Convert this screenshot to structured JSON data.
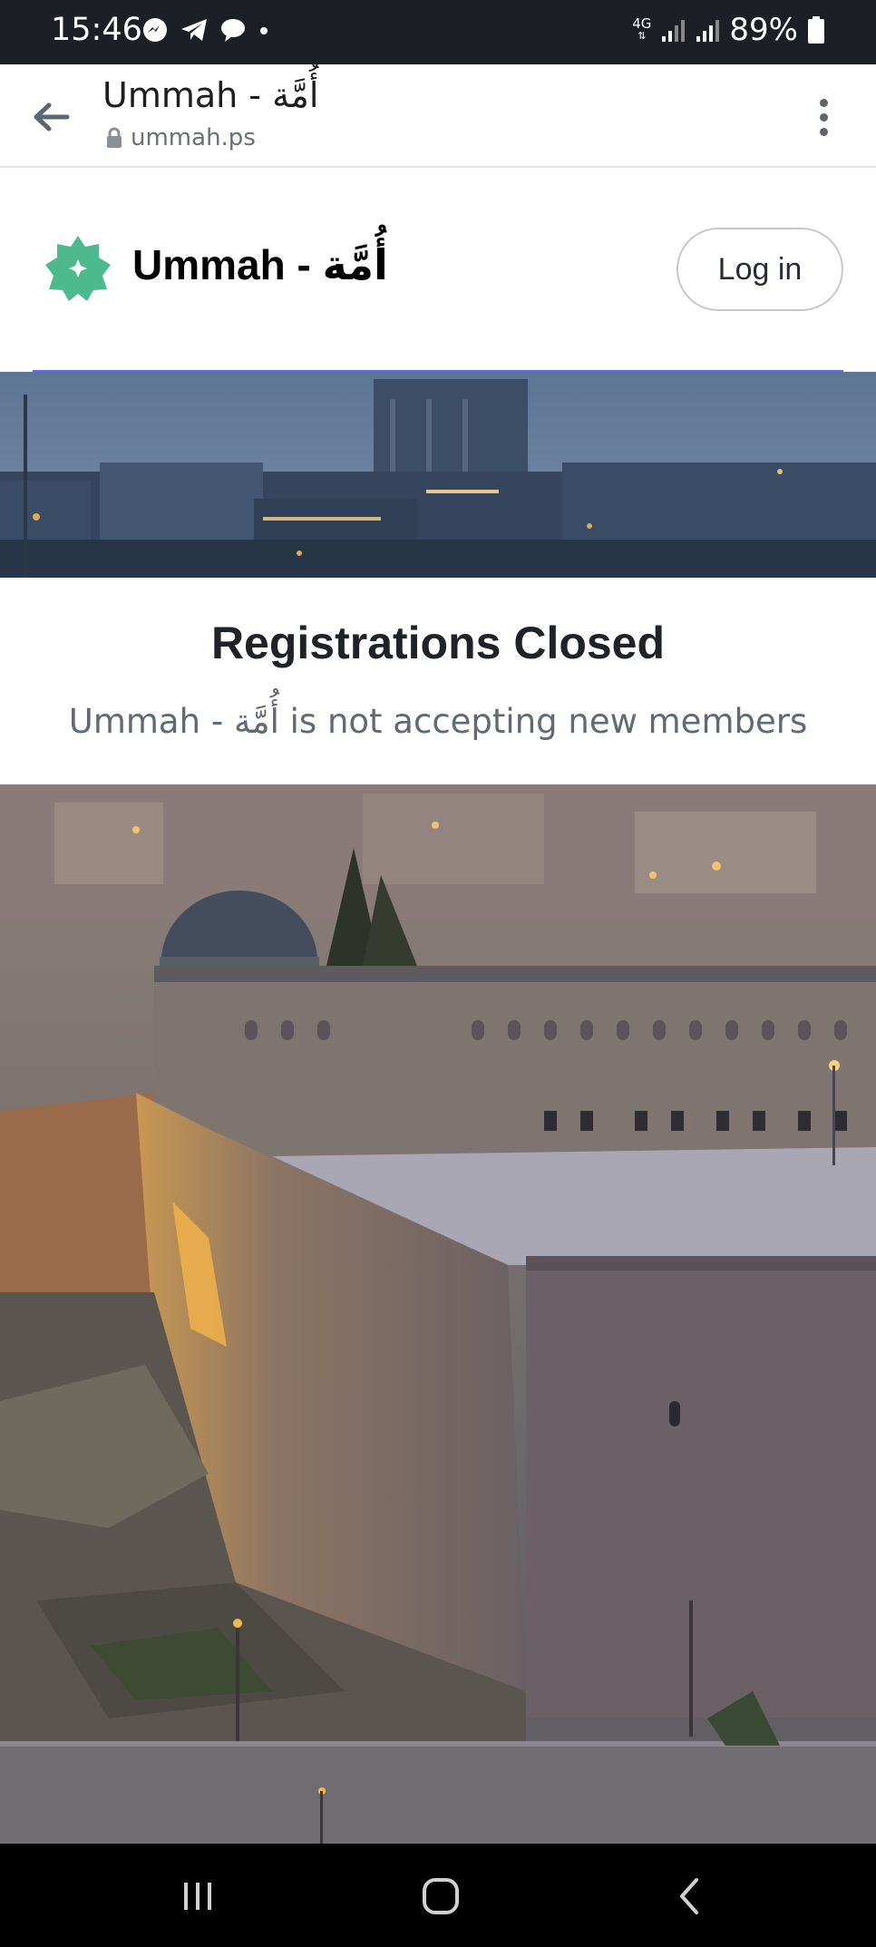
{
  "status_bar": {
    "time": "15:46",
    "network": "4G",
    "battery": "89%"
  },
  "browser": {
    "title": "Ummah - أُمَّة",
    "url": "ummah.ps"
  },
  "site": {
    "name": "Ummah - أُمَّة",
    "login_label": "Log in",
    "accent_color": "#6364ff",
    "logo_color": "#4fb98e"
  },
  "notice": {
    "title": "Registrations Closed",
    "subtitle": "Ummah - أُمَّة is not accepting new members"
  }
}
